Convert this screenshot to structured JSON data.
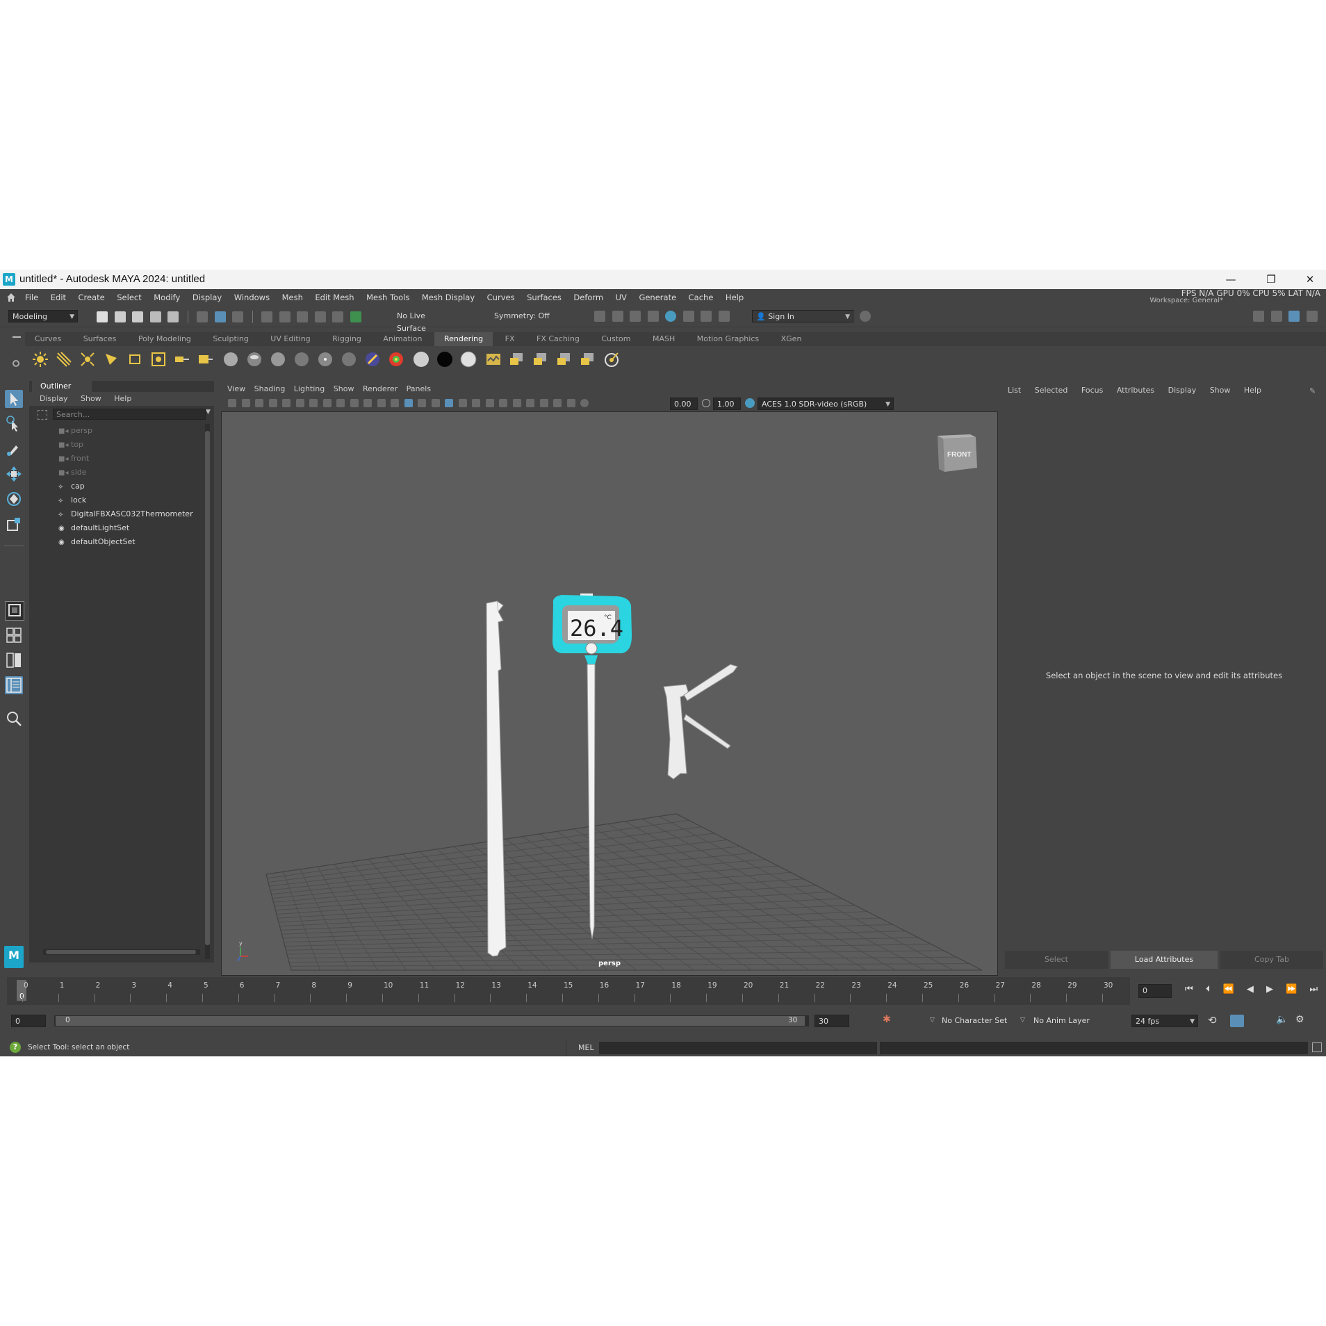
{
  "window": {
    "title": "untitled* - Autodesk MAYA 2024: untitled",
    "logo": "M",
    "minimize": "—",
    "maximize": "❐",
    "close": "✕"
  },
  "menubar": {
    "items": [
      "File",
      "Edit",
      "Create",
      "Select",
      "Modify",
      "Display",
      "Windows",
      "Mesh",
      "Edit Mesh",
      "Mesh Tools",
      "Mesh Display",
      "Curves",
      "Surfaces",
      "Deform",
      "UV",
      "Generate",
      "Cache",
      "Help"
    ],
    "stats": "FPS N/A GPU 0% CPU 5% LAT N/A",
    "workspace": "Workspace: General*"
  },
  "statusline": {
    "menuset": "Modeling",
    "live_surface": "No Live Surface",
    "symmetry": "Symmetry: Off",
    "sign_in": "Sign In"
  },
  "shelf": {
    "tabs": [
      "Curves",
      "Surfaces",
      "Poly Modeling",
      "Sculpting",
      "UV Editing",
      "Rigging",
      "Animation",
      "Rendering",
      "FX",
      "FX Caching",
      "Custom",
      "MASH",
      "Motion Graphics",
      "XGen"
    ],
    "active_tab": "Rendering"
  },
  "outliner": {
    "tab": "Outliner",
    "menu": [
      "Display",
      "Show",
      "Help"
    ],
    "search_placeholder": "Search...",
    "items": [
      {
        "label": "persp",
        "icon": "camera-icon",
        "dim": true
      },
      {
        "label": "top",
        "icon": "camera-icon",
        "dim": true
      },
      {
        "label": "front",
        "icon": "camera-icon",
        "dim": true
      },
      {
        "label": "side",
        "icon": "camera-icon",
        "dim": true
      },
      {
        "label": "cap",
        "icon": "transform-icon",
        "dim": false
      },
      {
        "label": "lock",
        "icon": "transform-icon",
        "dim": false
      },
      {
        "label": "DigitalFBXASC032Thermometer",
        "icon": "transform-icon",
        "dim": false
      },
      {
        "label": "defaultLightSet",
        "icon": "set-icon",
        "dim": false
      },
      {
        "label": "defaultObjectSet",
        "icon": "set-icon",
        "dim": false
      }
    ]
  },
  "viewport": {
    "menu": [
      "View",
      "Shading",
      "Lighting",
      "Show",
      "Renderer",
      "Panels"
    ],
    "exposure": "0.00",
    "gamma": "1.00",
    "color_space": "ACES 1.0 SDR-video (sRGB)",
    "camera_label": "persp",
    "viewcube_label": "FRONT",
    "display_reading": "26.4",
    "display_unit": "°C",
    "accent": "#2ad4e0"
  },
  "attribute_editor": {
    "menu": [
      "List",
      "Selected",
      "Focus",
      "Attributes",
      "Display",
      "Show",
      "Help"
    ],
    "message": "Select an object in the scene to view and edit its attributes",
    "buttons": [
      "Select",
      "Load Attributes",
      "Copy Tab"
    ]
  },
  "timeline": {
    "ticks": [
      "0",
      "1",
      "2",
      "3",
      "4",
      "5",
      "6",
      "7",
      "8",
      "9",
      "10",
      "11",
      "12",
      "13",
      "14",
      "15",
      "16",
      "17",
      "18",
      "19",
      "20",
      "21",
      "22",
      "23",
      "24",
      "25",
      "26",
      "27",
      "28",
      "29",
      "30"
    ],
    "current_frame_marker": "0",
    "current_frame": "0"
  },
  "range": {
    "start": "0",
    "inner_start": "0",
    "inner_end": "30",
    "end": "30",
    "character_set": "No Character Set",
    "anim_layer": "No Anim Layer",
    "fps": "24 fps"
  },
  "cmdline": {
    "help_text": "Select Tool: select an object",
    "language": "MEL"
  }
}
